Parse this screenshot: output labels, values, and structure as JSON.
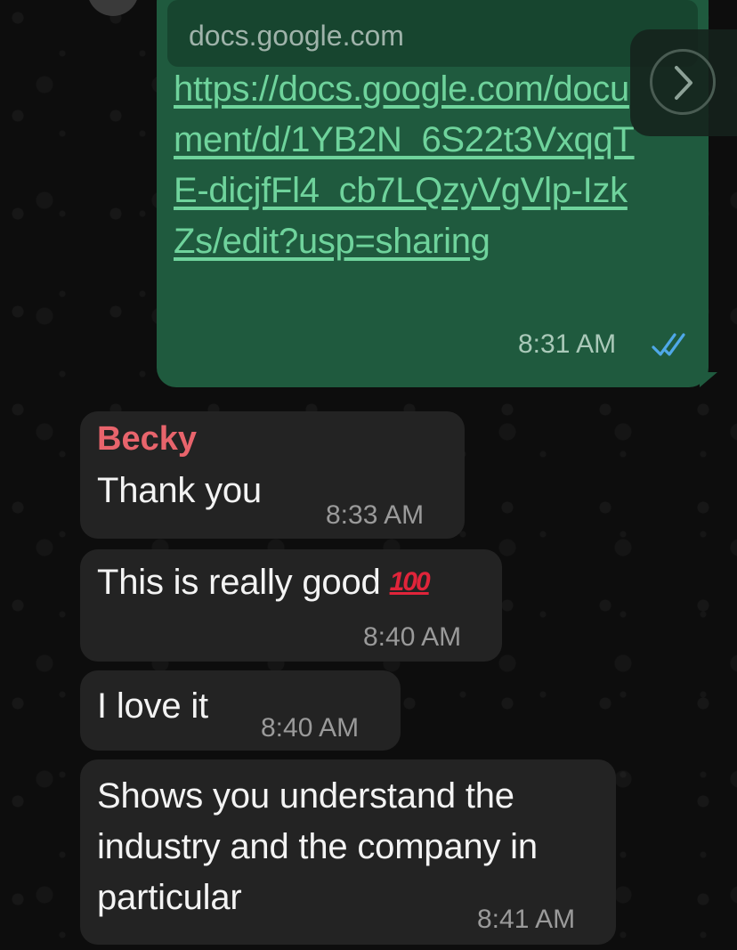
{
  "outgoing": {
    "preview_domain": "docs.google.com",
    "link_text": "https://docs.google.com/document/d/1YB2N_6S22t3VxqqTE-dicjfFl4_cb7LQzyVgVlp-IzkZs/edit?usp=sharing",
    "time": "8:31 AM",
    "status_icon": "double-check-read-icon",
    "bubble_color": "#1f5a3e",
    "link_color": "#6fd39c",
    "read_tick_color": "#4fa8e8"
  },
  "forward_button": {
    "icon": "chevron-right-icon"
  },
  "incoming": {
    "sender": "Becky",
    "sender_color": "#e8646c",
    "bubble_color": "#232323",
    "messages": [
      {
        "text": "Thank you",
        "time": "8:33 AM"
      },
      {
        "text": "This is really good",
        "emoji": "💯",
        "time": "8:40 AM"
      },
      {
        "text": "I love it",
        "time": "8:40 AM"
      },
      {
        "text": "Shows you understand the industry and the company in particular",
        "time": "8:41 AM"
      }
    ]
  }
}
